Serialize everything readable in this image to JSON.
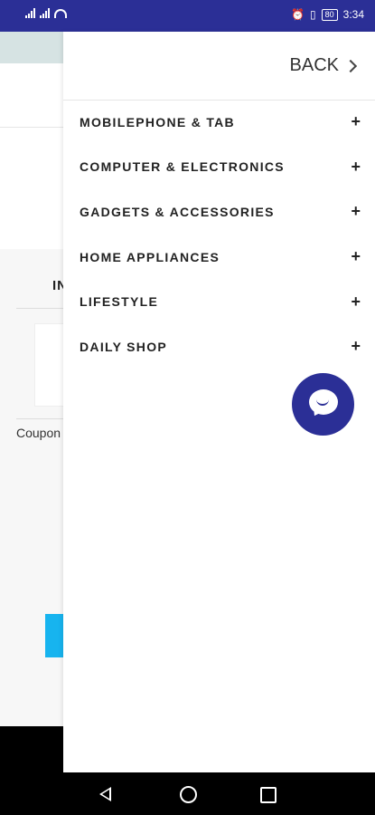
{
  "status_bar": {
    "left": "⁴ᴳ ⁴ᴳ",
    "battery": "80",
    "time": "3:34"
  },
  "background": {
    "tab_text": "IN",
    "coupon_text": "Coupon"
  },
  "drawer": {
    "back_label": "BACK",
    "menu": [
      {
        "label": "MOBILEPHONE & TAB"
      },
      {
        "label": "COMPUTER & ELECTRONICS"
      },
      {
        "label": "GADGETS & ACCESSORIES"
      },
      {
        "label": "HOME APPLIANCES"
      },
      {
        "label": "LIFESTYLE"
      },
      {
        "label": "DAILY SHOP"
      }
    ],
    "expand_symbol": "+"
  },
  "colors": {
    "primary": "#2b2f96",
    "accent": "#17b4ef"
  }
}
